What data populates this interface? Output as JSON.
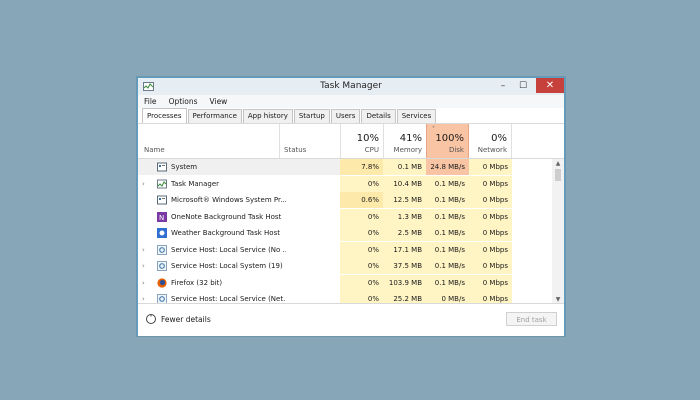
{
  "window": {
    "title": "Task Manager",
    "minimize": "–",
    "maximize": "☐",
    "close": "✕"
  },
  "menu": [
    "File",
    "Options",
    "View"
  ],
  "tabs": [
    {
      "label": "Processes",
      "active": true
    },
    {
      "label": "Performance",
      "active": false
    },
    {
      "label": "App history",
      "active": false
    },
    {
      "label": "Startup",
      "active": false
    },
    {
      "label": "Users",
      "active": false
    },
    {
      "label": "Details",
      "active": false
    },
    {
      "label": "Services",
      "active": false
    }
  ],
  "columns": {
    "name": "Name",
    "status": "Status",
    "cpu": {
      "pct": "10%",
      "label": "CPU"
    },
    "memory": {
      "pct": "41%",
      "label": "Memory"
    },
    "disk": {
      "pct": "100%",
      "label": "Disk"
    },
    "network": {
      "pct": "0%",
      "label": "Network"
    }
  },
  "rows": [
    {
      "name": "System",
      "icon": "system-icon",
      "expand": "",
      "cpu": "7.8%",
      "memory": "0.1 MB",
      "disk": "24.8 MB/s",
      "network": "0 Mbps"
    },
    {
      "name": "Task Manager",
      "icon": "task-manager-icon",
      "expand": "›",
      "cpu": "0%",
      "memory": "10.4 MB",
      "disk": "0.1 MB/s",
      "network": "0 Mbps"
    },
    {
      "name": "Microsoft® Windows System Pr...",
      "icon": "system-icon",
      "expand": "",
      "cpu": "0.6%",
      "memory": "12.5 MB",
      "disk": "0.1 MB/s",
      "network": "0 Mbps"
    },
    {
      "name": "OneNote Background Task Host",
      "icon": "onenote-icon",
      "expand": "",
      "cpu": "0%",
      "memory": "1.3 MB",
      "disk": "0.1 MB/s",
      "network": "0 Mbps"
    },
    {
      "name": "Weather Background Task Host",
      "icon": "weather-icon",
      "expand": "",
      "cpu": "0%",
      "memory": "2.5 MB",
      "disk": "0.1 MB/s",
      "network": "0 Mbps"
    },
    {
      "name": "Service Host: Local Service (No ...",
      "icon": "service-gear-icon",
      "expand": "›",
      "cpu": "0%",
      "memory": "17.1 MB",
      "disk": "0.1 MB/s",
      "network": "0 Mbps"
    },
    {
      "name": "Service Host: Local System (19)",
      "icon": "service-gear-icon",
      "expand": "›",
      "cpu": "0%",
      "memory": "37.5 MB",
      "disk": "0.1 MB/s",
      "network": "0 Mbps"
    },
    {
      "name": "Firefox (32 bit)",
      "icon": "firefox-icon",
      "expand": "›",
      "cpu": "0%",
      "memory": "103.9 MB",
      "disk": "0.1 MB/s",
      "network": "0 Mbps"
    },
    {
      "name": "Service Host: Local Service (Net...",
      "icon": "service-gear-icon",
      "expand": "›",
      "cpu": "0%",
      "memory": "25.2 MB",
      "disk": "0 MB/s",
      "network": "0 Mbps"
    }
  ],
  "footer": {
    "fewer_details": "Fewer details",
    "end_task": "End task"
  },
  "colors": {
    "disk_header": "#f9c4a3",
    "cell_light": "#fff4c4",
    "cell_medium": "#fde9a9",
    "close": "#c7413c",
    "background": "#87a7b9"
  }
}
